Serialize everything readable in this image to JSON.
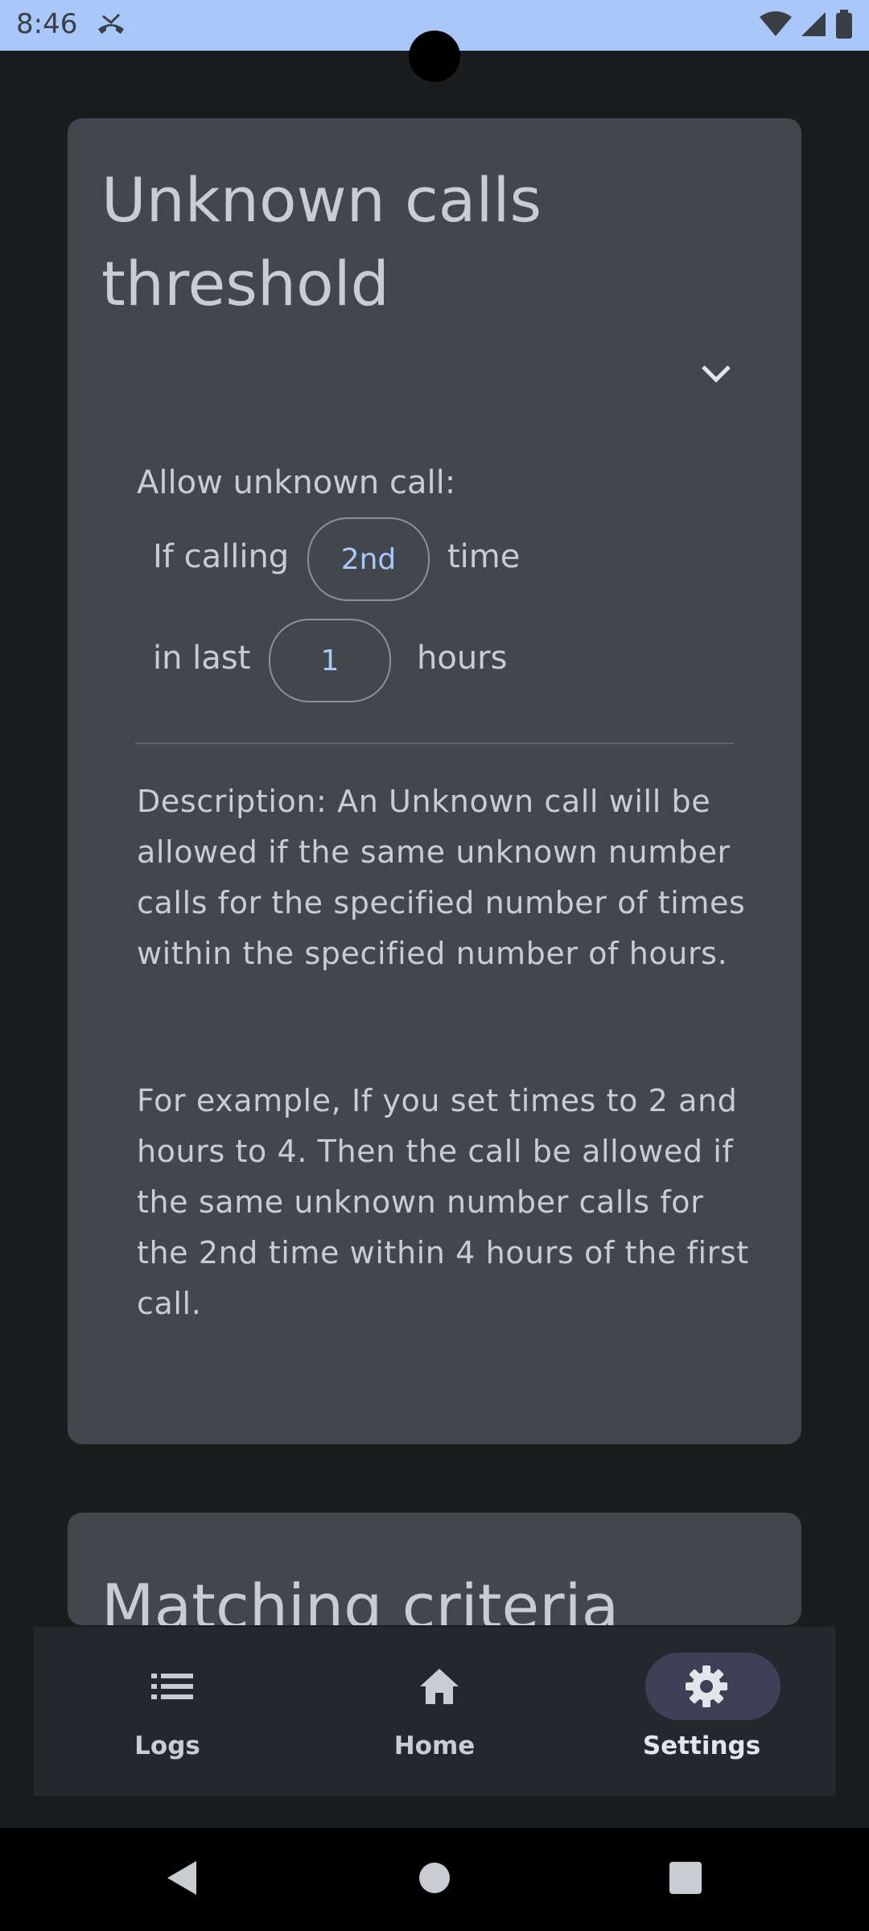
{
  "status_bar": {
    "time": "8:46",
    "icons": [
      "missed-call-icon",
      "wifi-icon",
      "signal-icon",
      "battery-icon"
    ]
  },
  "threshold_card": {
    "title": "Unknown calls threshold",
    "allow_label": "Allow unknown call:",
    "if_calling_label": "If calling",
    "times_value": "2nd",
    "time_label": "time",
    "in_last_label": "in last",
    "hours_value": "1",
    "hours_label": "hours",
    "description": "Description: An Unknown call will be allowed if the same unknown number calls for the specified number of times within the specified number of hours.",
    "example": "For example, If you set times to 2 and hours to 4. Then the call be allowed if the same unknown number calls for the 2nd time within 4 hours of the first call."
  },
  "matching_card": {
    "title": "Matching criteria"
  },
  "bottom_nav": {
    "items": [
      {
        "label": "Logs",
        "icon": "list-icon",
        "active": false
      },
      {
        "label": "Home",
        "icon": "home-icon",
        "active": false
      },
      {
        "label": "Settings",
        "icon": "gear-icon",
        "active": true
      }
    ]
  },
  "colors": {
    "background": "#1a1c1e",
    "card": "#42474e",
    "accent": "#a9c7f9",
    "active_indicator": "#3e4058",
    "nav_background": "#24272c"
  }
}
